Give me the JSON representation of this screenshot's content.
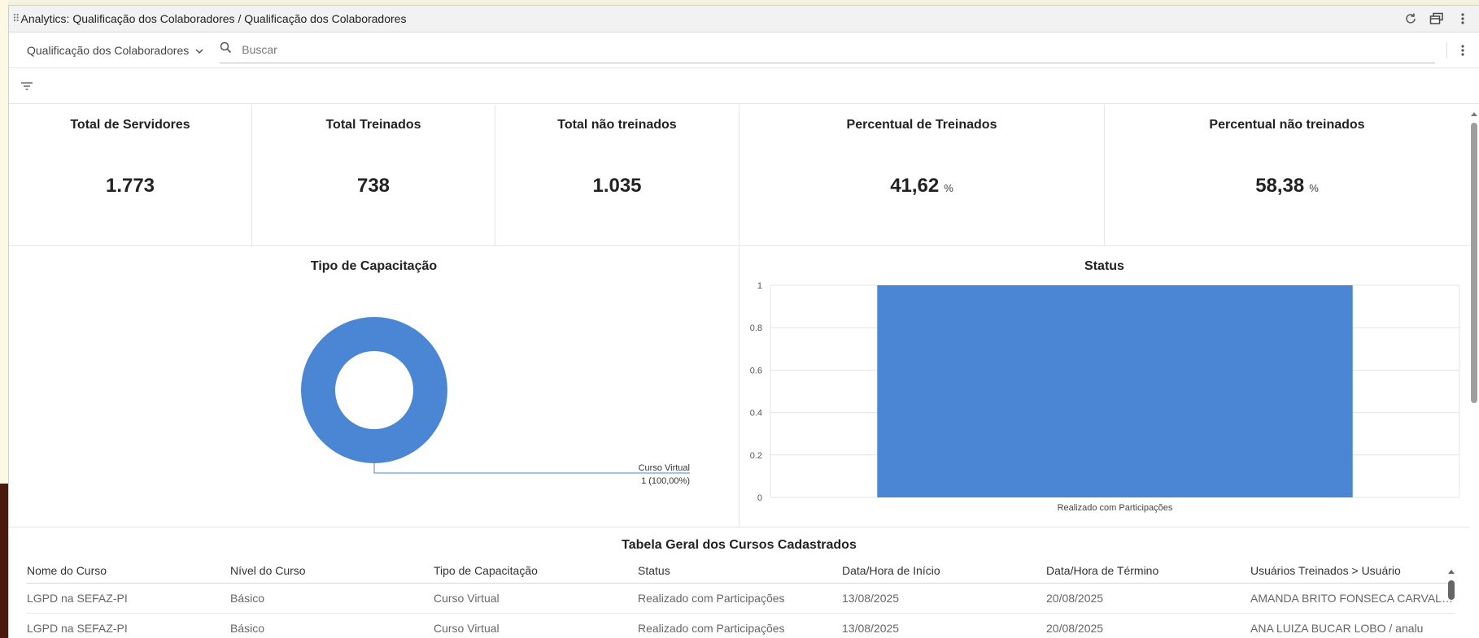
{
  "window": {
    "title": "Analytics: Qualificação dos Colaboradores / Qualificação dos Colaboradores"
  },
  "toolbar": {
    "dashboard_select": "Qualificação dos Colaboradores",
    "search_placeholder": "Buscar"
  },
  "kpis": [
    {
      "label": "Total de Servidores",
      "value": "1.773",
      "unit": ""
    },
    {
      "label": "Total Treinados",
      "value": "738",
      "unit": ""
    },
    {
      "label": "Total não treinados",
      "value": "1.035",
      "unit": ""
    },
    {
      "label": "Percentual de Treinados",
      "value": "41,62",
      "unit": "%"
    },
    {
      "label": "Percentual não treinados",
      "value": "58,38",
      "unit": "%"
    }
  ],
  "chart_data": [
    {
      "type": "pie",
      "title": "Tipo de Capacitação",
      "categories": [
        "Curso Virtual"
      ],
      "values": [
        1
      ],
      "data_labels": [
        "1 (100,00%)"
      ],
      "colors": [
        "#4a86d4"
      ]
    },
    {
      "type": "bar",
      "title": "Status",
      "categories": [
        "Realizado com Participações"
      ],
      "values": [
        1
      ],
      "ylim": [
        0,
        1
      ],
      "yticks": [
        "0",
        "0.2",
        "0.4",
        "0.6",
        "0.8",
        "1"
      ],
      "grid": true,
      "colors": [
        "#4a86d4"
      ]
    }
  ],
  "table": {
    "title": "Tabela Geral dos Cursos Cadastrados",
    "columns": [
      "Nome do Curso",
      "Nível do Curso",
      "Tipo de Capacitação",
      "Status",
      "Data/Hora de Início",
      "Data/Hora de Término",
      "Usuários Treinados > Usuário"
    ],
    "rows": [
      [
        "LGPD na SEFAZ-PI",
        "Básico",
        "Curso Virtual",
        "Realizado com Participações",
        "13/08/2025",
        "20/08/2025",
        "AMANDA BRITO FONSECA CARVALH..."
      ],
      [
        "LGPD na SEFAZ-PI",
        "Básico",
        "Curso Virtual",
        "Realizado com Participações",
        "13/08/2025",
        "20/08/2025",
        "ANA LUIZA BUCAR LOBO / analu"
      ]
    ]
  },
  "icons": {
    "refresh": "refresh-icon",
    "window": "window-icon",
    "more": "more-vertical-icon",
    "search": "search-icon",
    "filter": "filter-icon",
    "chevron": "chevron-down-icon"
  }
}
